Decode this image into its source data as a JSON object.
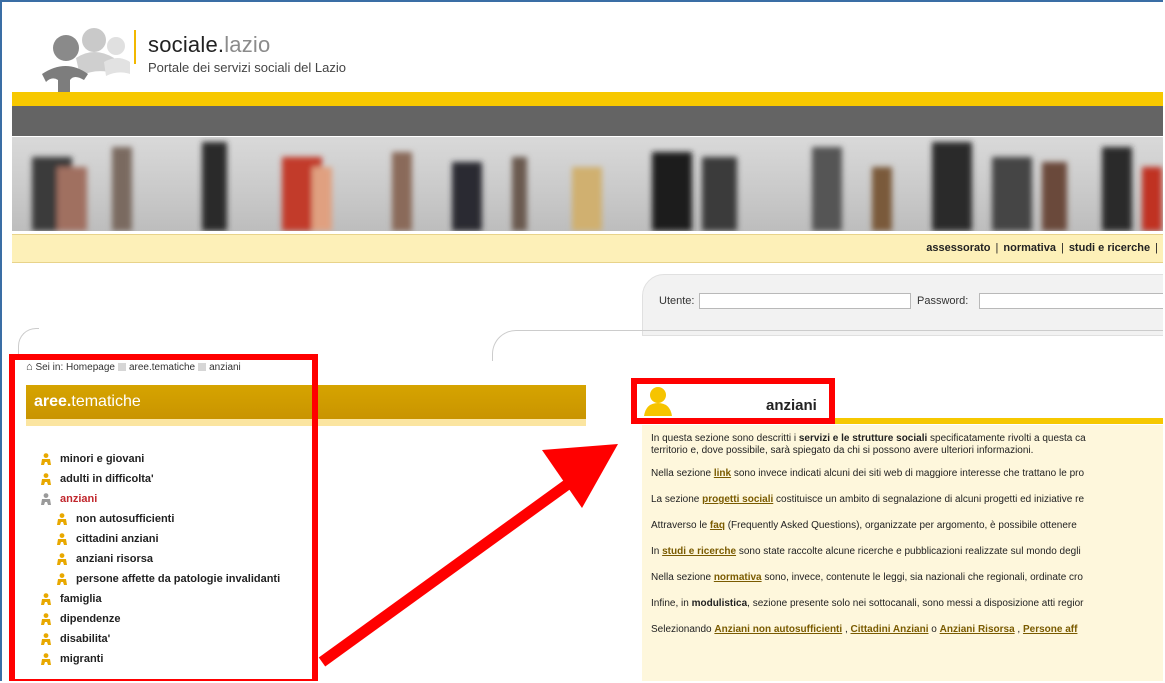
{
  "header": {
    "brand_bold": "sociale.",
    "brand_light": "lazio",
    "subtitle": "Portale dei servizi sociali del Lazio",
    "logo": "people-logo"
  },
  "nav": {
    "links": [
      "assessorato",
      "normativa",
      "studi e ricerche"
    ]
  },
  "login": {
    "user_label": "Utente:",
    "password_label": "Password:",
    "user_value": "",
    "password_value": ""
  },
  "breadcrumb": {
    "prefix": "Sei in:",
    "items": [
      "Homepage",
      "aree.tematiche",
      "anziani"
    ]
  },
  "sidebar": {
    "title_bold": "aree.",
    "title_light": "tematiche",
    "items": [
      {
        "label": "minori e giovani",
        "level": 0,
        "active": false
      },
      {
        "label": "adulti in difficolta'",
        "level": 0,
        "active": false
      },
      {
        "label": "anziani",
        "level": 0,
        "active": true
      },
      {
        "label": "non autosufficienti",
        "level": 1,
        "active": false
      },
      {
        "label": "cittadini anziani",
        "level": 1,
        "active": false
      },
      {
        "label": "anziani risorsa",
        "level": 1,
        "active": false
      },
      {
        "label": "persone affette da patologie invalidanti",
        "level": 1,
        "active": false
      },
      {
        "label": "famiglia",
        "level": 0,
        "active": false
      },
      {
        "label": "dipendenze",
        "level": 0,
        "active": false
      },
      {
        "label": "disabilita'",
        "level": 0,
        "active": false
      },
      {
        "label": "migranti",
        "level": 0,
        "active": false
      }
    ]
  },
  "section": {
    "title": "anziani",
    "p1a": "In questa sezione sono descritti i ",
    "p1b": "servizi e le strutture sociali",
    "p1c": " specificatamente rivolti a questa ca",
    "p1d": "territorio e, dove possibile, sarà spiegato da chi si possono avere ulteriori informazioni.",
    "p2a": "Nella sezione ",
    "p2link": "link",
    "p2b": " sono invece indicati alcuni dei siti web di maggiore interesse che trattano le pro",
    "p3a": "La sezione ",
    "p3link": "progetti sociali",
    "p3b": " costituisce un ambito di segnalazione di alcuni progetti ed iniziative re",
    "p4a": "Attraverso le ",
    "p4link": "faq",
    "p4b": " (Frequently Asked Questions), organizzate per argomento, è possibile ottenere",
    "p5a": "In ",
    "p5link": "studi e ricerche",
    "p5b": " sono state raccolte alcune ricerche e pubblicazioni realizzate sul mondo degli",
    "p6a": "Nella sezione ",
    "p6link": "normativa",
    "p6b": " sono, invece, contenute le leggi, sia nazionali che regionali, ordinate cro",
    "p7a": "Infine, in ",
    "p7b": "modulistica",
    "p7c": ", sezione presente solo nei sottocanali, sono messi a disposizione atti regior",
    "p8a": "Selezionando ",
    "p8link1": "Anziani non autosufficienti",
    "p8sep1": " , ",
    "p8link2": "Cittadini Anziani",
    "p8sep2": " o ",
    "p8link3": "Anziani Risorsa",
    "p8sep3": " , ",
    "p8link4": "Persone aff"
  },
  "colors": {
    "accent_yellow": "#f7c800",
    "highlight_red": "#ff0000",
    "active_item": "#c1272d"
  }
}
